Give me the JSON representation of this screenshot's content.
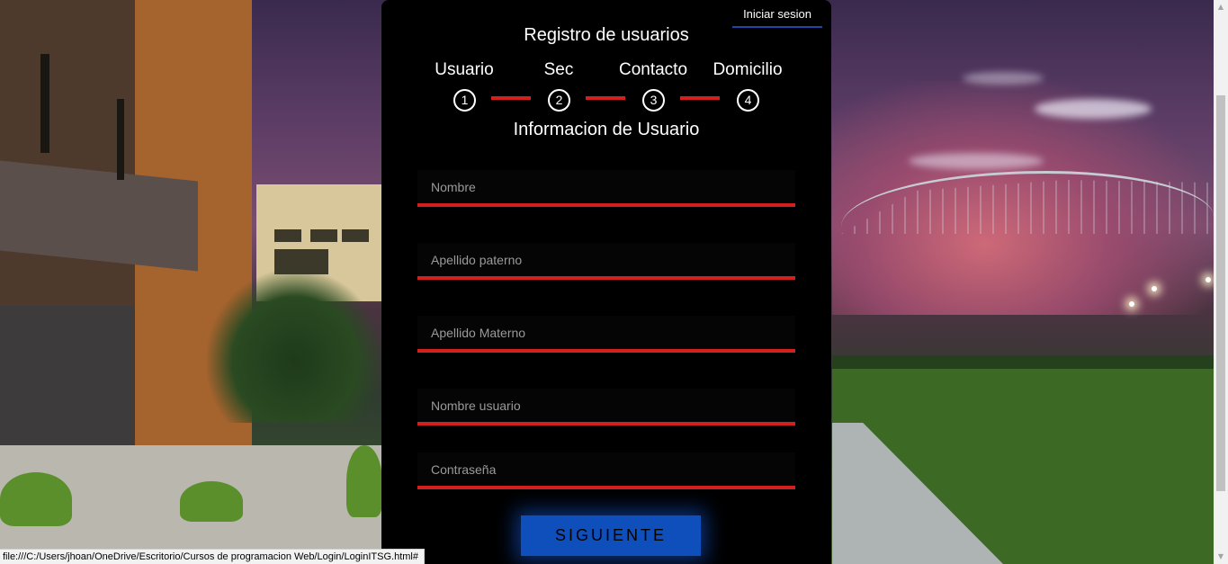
{
  "header": {
    "login_link": "Iniciar sesion",
    "title": "Registro de usuarios"
  },
  "steps": [
    {
      "label": "Usuario",
      "number": "1"
    },
    {
      "label": "Sec",
      "number": "2"
    },
    {
      "label": "Contacto",
      "number": "3"
    },
    {
      "label": "Domicilio",
      "number": "4"
    }
  ],
  "form": {
    "section_title": "Informacion de Usuario",
    "fields": [
      {
        "placeholder": "Nombre"
      },
      {
        "placeholder": "Apellido paterno"
      },
      {
        "placeholder": "Apellido Materno"
      },
      {
        "placeholder": "Nombre usuario"
      },
      {
        "placeholder": "Contraseña"
      }
    ],
    "submit_label": "SIGUIENTE"
  },
  "status_bar": {
    "url": "file:///C:/Users/jhoan/OneDrive/Escritorio/Cursos de programacion Web/Login/LoginITSG.html#"
  },
  "colors": {
    "accent_red": "#d3201f",
    "button_blue": "#0f4fbb",
    "card_bg": "#000000"
  }
}
